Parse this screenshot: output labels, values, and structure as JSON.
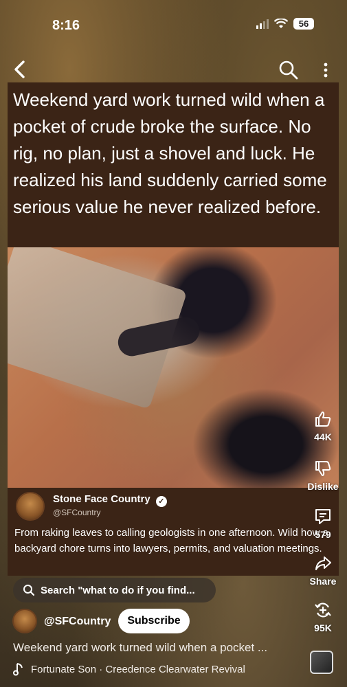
{
  "status_bar": {
    "time": "8:16",
    "battery": "56"
  },
  "nav": {
    "back_icon": "chevron-left-icon",
    "search_icon": "search-icon",
    "more_icon": "more-vertical-icon"
  },
  "caption": {
    "text": "Weekend yard work turned wild when a pocket of crude broke the surface. No rig, no plan, just a shovel and luck. He realized his land suddenly carried some serious value he never realized before."
  },
  "post": {
    "name": "Stone Face Country",
    "handle": "@SFCountry",
    "body": "From raking leaves to calling geologists in one afternoon. Wild how a backyard chore turns into lawyers, permits, and valuation meetings."
  },
  "actions": {
    "like_count": "44K",
    "dislike_label": "Dislike",
    "comment_count": "579",
    "share_label": "Share",
    "remix_count": "95K"
  },
  "search_chip": {
    "label": "Search \"what to do if you find..."
  },
  "channel": {
    "handle": "@SFCountry",
    "subscribe_label": "Subscribe"
  },
  "description": "Weekend yard work turned wild when a pocket ...",
  "music": {
    "track": "Fortunate Son · Creedence Clearwater Revival"
  }
}
